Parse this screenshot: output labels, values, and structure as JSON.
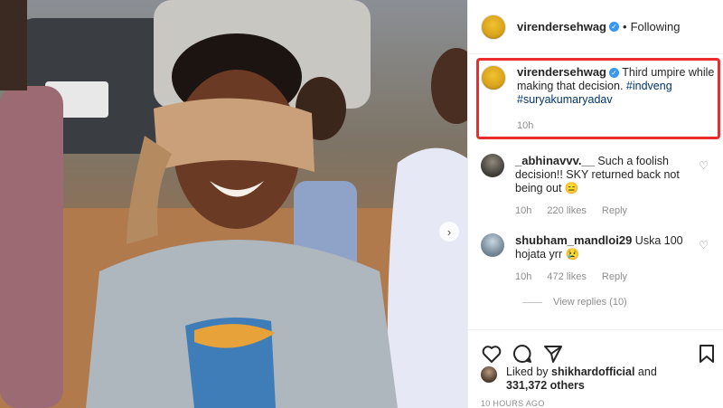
{
  "post": {
    "next_icon": "chevron-right-icon"
  },
  "header": {
    "username": "virendersehwag",
    "separator": "•",
    "follow_status": "Following"
  },
  "caption": {
    "username": "virendersehwag",
    "text": "Third umpire while making that decision.",
    "hashtag1": "#indveng",
    "hashtag2": "#suryakumaryadav",
    "time": "10h",
    "highlight_color": "#ea2c2c"
  },
  "comments": [
    {
      "username": "_abhinavvv.__",
      "text": "Such a foolish decision!! SKY returned back not being out 😑",
      "time": "10h",
      "likes": "220 likes",
      "reply": "Reply"
    },
    {
      "username": "shubham_mandloi29",
      "text": "Uska 100 hojata yrr 😢",
      "time": "10h",
      "likes": "472 likes",
      "reply": "Reply",
      "view_replies": "View replies (10)"
    }
  ],
  "footer": {
    "liked_by_prefix": "Liked by",
    "liked_by_user": "shikhardofficial",
    "liked_by_and": "and",
    "liked_by_count": "331,372 others",
    "timestamp": "10 HOURS AGO",
    "icons": [
      "heart-icon",
      "comment-icon",
      "share-icon",
      "bookmark-icon"
    ]
  }
}
